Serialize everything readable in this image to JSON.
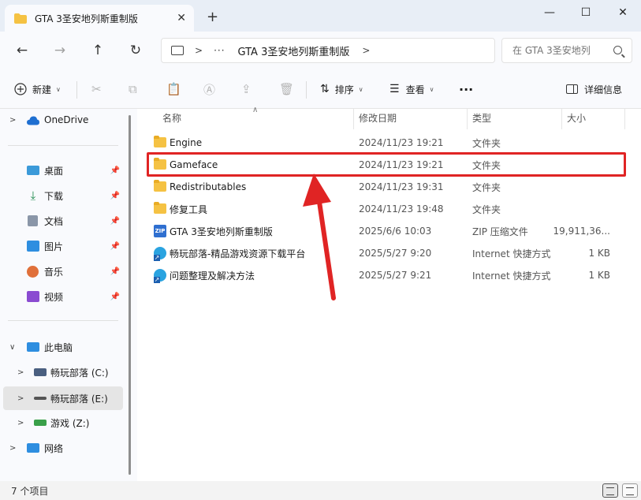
{
  "window": {
    "tab_title": "GTA 3圣安地列斯重制版",
    "tab_close": "✕",
    "new_tab": "+",
    "minimize": "—",
    "maximize": "☐",
    "close": "✕"
  },
  "nav": {
    "back": "←",
    "forward": "→",
    "up": "↑",
    "refresh": "↻",
    "address_dots": "···",
    "address_crumb": "GTA 3圣安地列斯重制版",
    "search_placeholder": "在 GTA 3圣安地列"
  },
  "toolbar": {
    "new_label": "新建",
    "sort_label": "排序",
    "view_label": "查看",
    "more_label": "···",
    "details_label": "详细信息"
  },
  "sidebar": {
    "items": [
      {
        "label": "OneDrive",
        "icon": "cloud-icon",
        "color": "#1f6fd1"
      },
      {
        "label": "桌面",
        "icon": "desktop-icon",
        "color": "#3b9ad9"
      },
      {
        "label": "下载",
        "icon": "download-icon",
        "color": "#1e8b4d"
      },
      {
        "label": "文档",
        "icon": "document-icon",
        "color": "#8a96a8"
      },
      {
        "label": "图片",
        "icon": "pictures-icon",
        "color": "#2e8ee0"
      },
      {
        "label": "音乐",
        "icon": "music-icon",
        "color": "#e0703a"
      },
      {
        "label": "视频",
        "icon": "video-icon",
        "color": "#8a4bd1"
      },
      {
        "label": "此电脑",
        "icon": "computer-icon",
        "color": "#2e8ee0"
      },
      {
        "label": "畅玩部落 (C:)",
        "icon": "drive-c-icon",
        "color": "#4a5f80"
      },
      {
        "label": "畅玩部落 (E:)",
        "icon": "drive-e-icon",
        "color": "#555555"
      },
      {
        "label": "游戏 (Z:)",
        "icon": "drive-z-icon",
        "color": "#3aa04a"
      },
      {
        "label": "网络",
        "icon": "network-icon",
        "color": "#2e8ee0"
      }
    ]
  },
  "columns": {
    "name": "名称",
    "date": "修改日期",
    "type": "类型",
    "size": "大小"
  },
  "files": [
    {
      "name": "Engine",
      "date": "2024/11/23 19:21",
      "type": "文件夹",
      "size": "",
      "kind": "folder"
    },
    {
      "name": "Gameface",
      "date": "2024/11/23 19:21",
      "type": "文件夹",
      "size": "",
      "kind": "folder"
    },
    {
      "name": "Redistributables",
      "date": "2024/11/23 19:31",
      "type": "文件夹",
      "size": "",
      "kind": "folder"
    },
    {
      "name": "修复工具",
      "date": "2024/11/23 19:48",
      "type": "文件夹",
      "size": "",
      "kind": "folder"
    },
    {
      "name": "GTA 3圣安地列斯重制版",
      "date": "2025/6/6 10:03",
      "type": "ZIP 压缩文件",
      "size": "19,911,36...",
      "kind": "zip"
    },
    {
      "name": "畅玩部落-精品游戏资源下载平台",
      "date": "2025/5/27 9:20",
      "type": "Internet 快捷方式",
      "size": "1 KB",
      "kind": "link"
    },
    {
      "name": "问题整理及解决方法",
      "date": "2025/5/27 9:21",
      "type": "Internet 快捷方式",
      "size": "1 KB",
      "kind": "link"
    }
  ],
  "status": {
    "count": "7 个项目"
  },
  "colors": {
    "highlight": "#e02424",
    "accent": "#0067c0"
  }
}
